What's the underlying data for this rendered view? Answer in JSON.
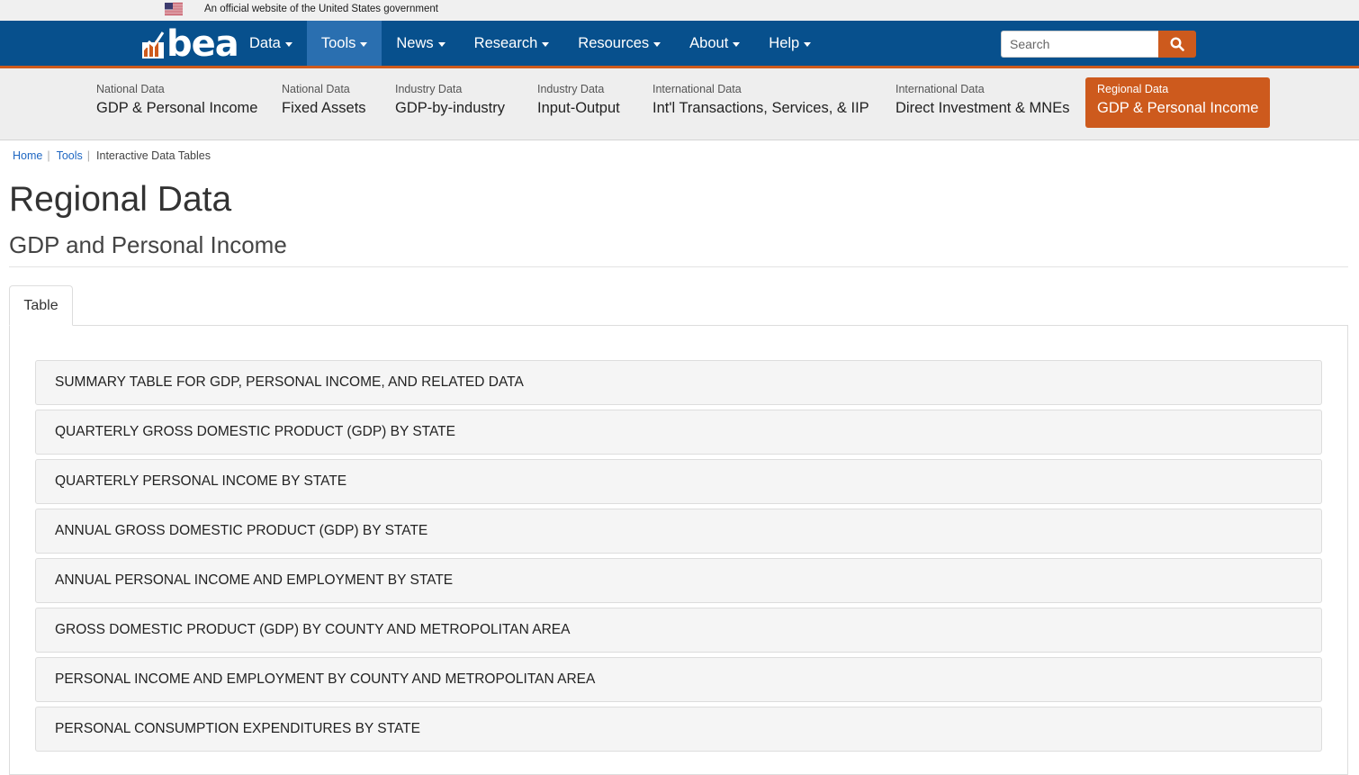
{
  "gov_banner": {
    "text": "An official website of the United States government"
  },
  "logo": {
    "text": "bea"
  },
  "nav": {
    "items": [
      {
        "label": "Data",
        "active": false
      },
      {
        "label": "Tools",
        "active": true
      },
      {
        "label": "News",
        "active": false
      },
      {
        "label": "Research",
        "active": false
      },
      {
        "label": "Resources",
        "active": false
      },
      {
        "label": "About",
        "active": false
      },
      {
        "label": "Help",
        "active": false
      }
    ],
    "search_placeholder": "Search"
  },
  "subnav": {
    "items": [
      {
        "category": "National Data",
        "label": "GDP & Personal Income"
      },
      {
        "category": "National Data",
        "label": "Fixed Assets"
      },
      {
        "category": "Industry Data",
        "label": "GDP-by-industry"
      },
      {
        "category": "Industry Data",
        "label": "Input-Output"
      },
      {
        "category": "International Data",
        "label": "Int'l Transactions, Services, & IIP"
      },
      {
        "category": "International Data",
        "label": "Direct Investment & MNEs"
      },
      {
        "category": "Regional Data",
        "label": "GDP & Personal Income"
      }
    ]
  },
  "breadcrumb": {
    "home": "Home",
    "tools": "Tools",
    "current": "Interactive Data Tables"
  },
  "page": {
    "title": "Regional Data",
    "subtitle": "GDP and Personal Income"
  },
  "tabs": [
    {
      "label": "Table"
    }
  ],
  "tables": [
    "SUMMARY TABLE FOR GDP, PERSONAL INCOME, AND RELATED DATA",
    "QUARTERLY GROSS DOMESTIC PRODUCT (GDP) BY STATE",
    "QUARTERLY PERSONAL INCOME BY STATE",
    "ANNUAL GROSS DOMESTIC PRODUCT (GDP) BY STATE",
    "ANNUAL PERSONAL INCOME AND EMPLOYMENT BY STATE",
    "GROSS DOMESTIC PRODUCT (GDP) BY COUNTY AND METROPOLITAN AREA",
    "PERSONAL INCOME AND EMPLOYMENT BY COUNTY AND METROPOLITAN AREA",
    "PERSONAL CONSUMPTION EXPENDITURES BY STATE"
  ],
  "colors": {
    "nav_bg": "#07508d",
    "nav_active": "#2a6fb0",
    "accent": "#cd5a1d",
    "link": "#1f67c2"
  }
}
